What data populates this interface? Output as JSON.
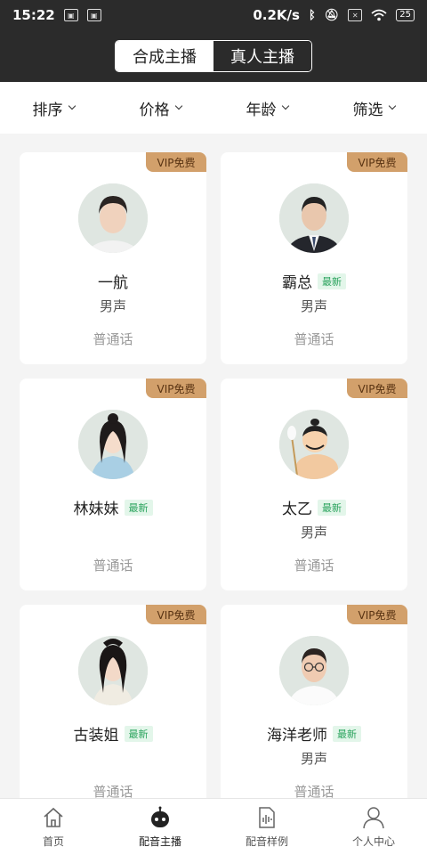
{
  "status_bar": {
    "time": "15:22",
    "network_speed": "0.2K/s",
    "battery": "25",
    "icons": [
      "notification-icon",
      "notification-icon",
      "bluetooth-icon",
      "mute-icon",
      "sim-off-icon",
      "wifi-icon",
      "battery-icon"
    ]
  },
  "segment": {
    "tabs": [
      {
        "label": "合成主播",
        "active": true
      },
      {
        "label": "真人主播",
        "active": false
      }
    ]
  },
  "filters": [
    {
      "label": "排序"
    },
    {
      "label": "价格"
    },
    {
      "label": "年龄"
    },
    {
      "label": "筛选"
    }
  ],
  "cards": [
    {
      "vip": "VIP免费",
      "name": "一航",
      "badge": "",
      "gender": "男声",
      "language": "普通话",
      "avatar": "young-man-avatar"
    },
    {
      "vip": "VIP免费",
      "name": "霸总",
      "badge": "最新",
      "gender": "男声",
      "language": "普通话",
      "avatar": "businessman-avatar"
    },
    {
      "vip": "VIP免费",
      "name": "林妹妹",
      "badge": "最新",
      "gender": "",
      "language": "普通话",
      "avatar": "ancient-girl-avatar"
    },
    {
      "vip": "VIP免费",
      "name": "太乙",
      "badge": "最新",
      "gender": "男声",
      "language": "普通话",
      "avatar": "taiyi-cartoon-avatar"
    },
    {
      "vip": "VIP免费",
      "name": "古装姐",
      "badge": "最新",
      "gender": "",
      "language": "普通话",
      "avatar": "ancient-lady-avatar"
    },
    {
      "vip": "VIP免费",
      "name": "海洋老师",
      "badge": "最新",
      "gender": "男声",
      "language": "普通话",
      "avatar": "teacher-avatar"
    }
  ],
  "tabbar": [
    {
      "label": "首页",
      "icon": "home-icon",
      "active": false
    },
    {
      "label": "配音主播",
      "icon": "robot-icon",
      "active": true
    },
    {
      "label": "配音样例",
      "icon": "audio-file-icon",
      "active": false
    },
    {
      "label": "个人中心",
      "icon": "user-icon",
      "active": false
    }
  ]
}
